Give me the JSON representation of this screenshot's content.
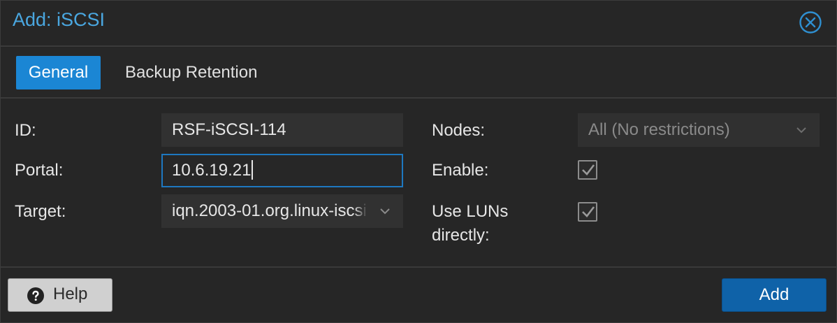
{
  "dialog": {
    "title": "Add: iSCSI",
    "close_icon": "close-circle-icon",
    "accent_color": "#1b86d4"
  },
  "tabs": [
    {
      "label": "General",
      "active": true
    },
    {
      "label": "Backup Retention",
      "active": false
    }
  ],
  "form": {
    "id": {
      "label": "ID:",
      "value": "RSF-iSCSI-114"
    },
    "portal": {
      "label": "Portal:",
      "value": "10.6.19.21"
    },
    "target": {
      "label": "Target:",
      "value": "iqn.2003-01.org.linux-iscsi"
    },
    "nodes": {
      "label": "Nodes:",
      "value": "All (No restrictions)",
      "disabled": true
    },
    "enable": {
      "label": "Enable:",
      "checked": true
    },
    "use_luns": {
      "label_line1": "Use LUNs",
      "label_line2": "directly:",
      "checked": true
    }
  },
  "footer": {
    "help_label": "Help",
    "help_icon": "question-circle-icon",
    "add_label": "Add"
  }
}
